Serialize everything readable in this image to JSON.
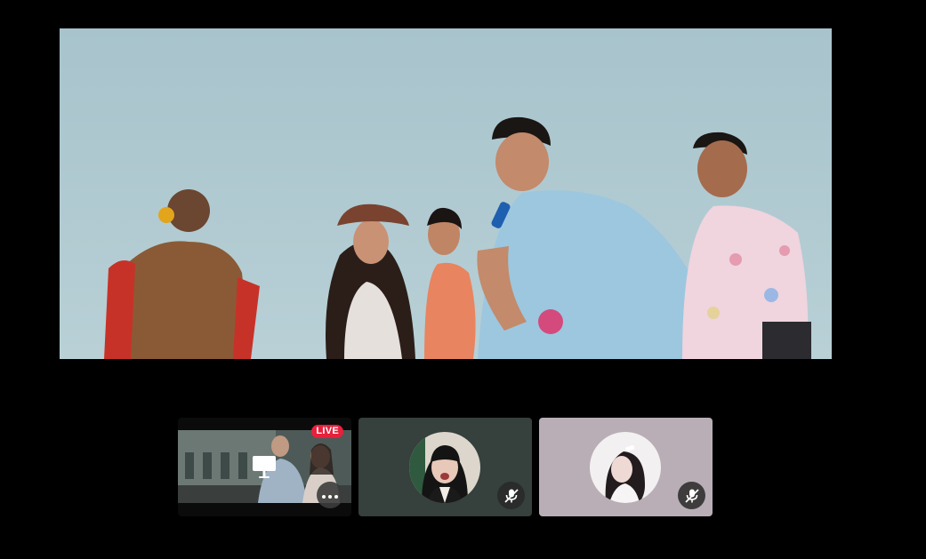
{
  "main_stage": {
    "content": "shared-screen-video"
  },
  "tiles": [
    {
      "kind": "screen-share",
      "badge": "LIVE",
      "badge_color": "#e8203c",
      "center_icon": "monitor-icon",
      "action_icon": "more-options-icon"
    },
    {
      "kind": "participant",
      "background_color": "#36403c",
      "status_icon": "microphone-muted-icon"
    },
    {
      "kind": "participant",
      "background_color": "#b9aeb6",
      "status_icon": "microphone-muted-icon"
    }
  ]
}
